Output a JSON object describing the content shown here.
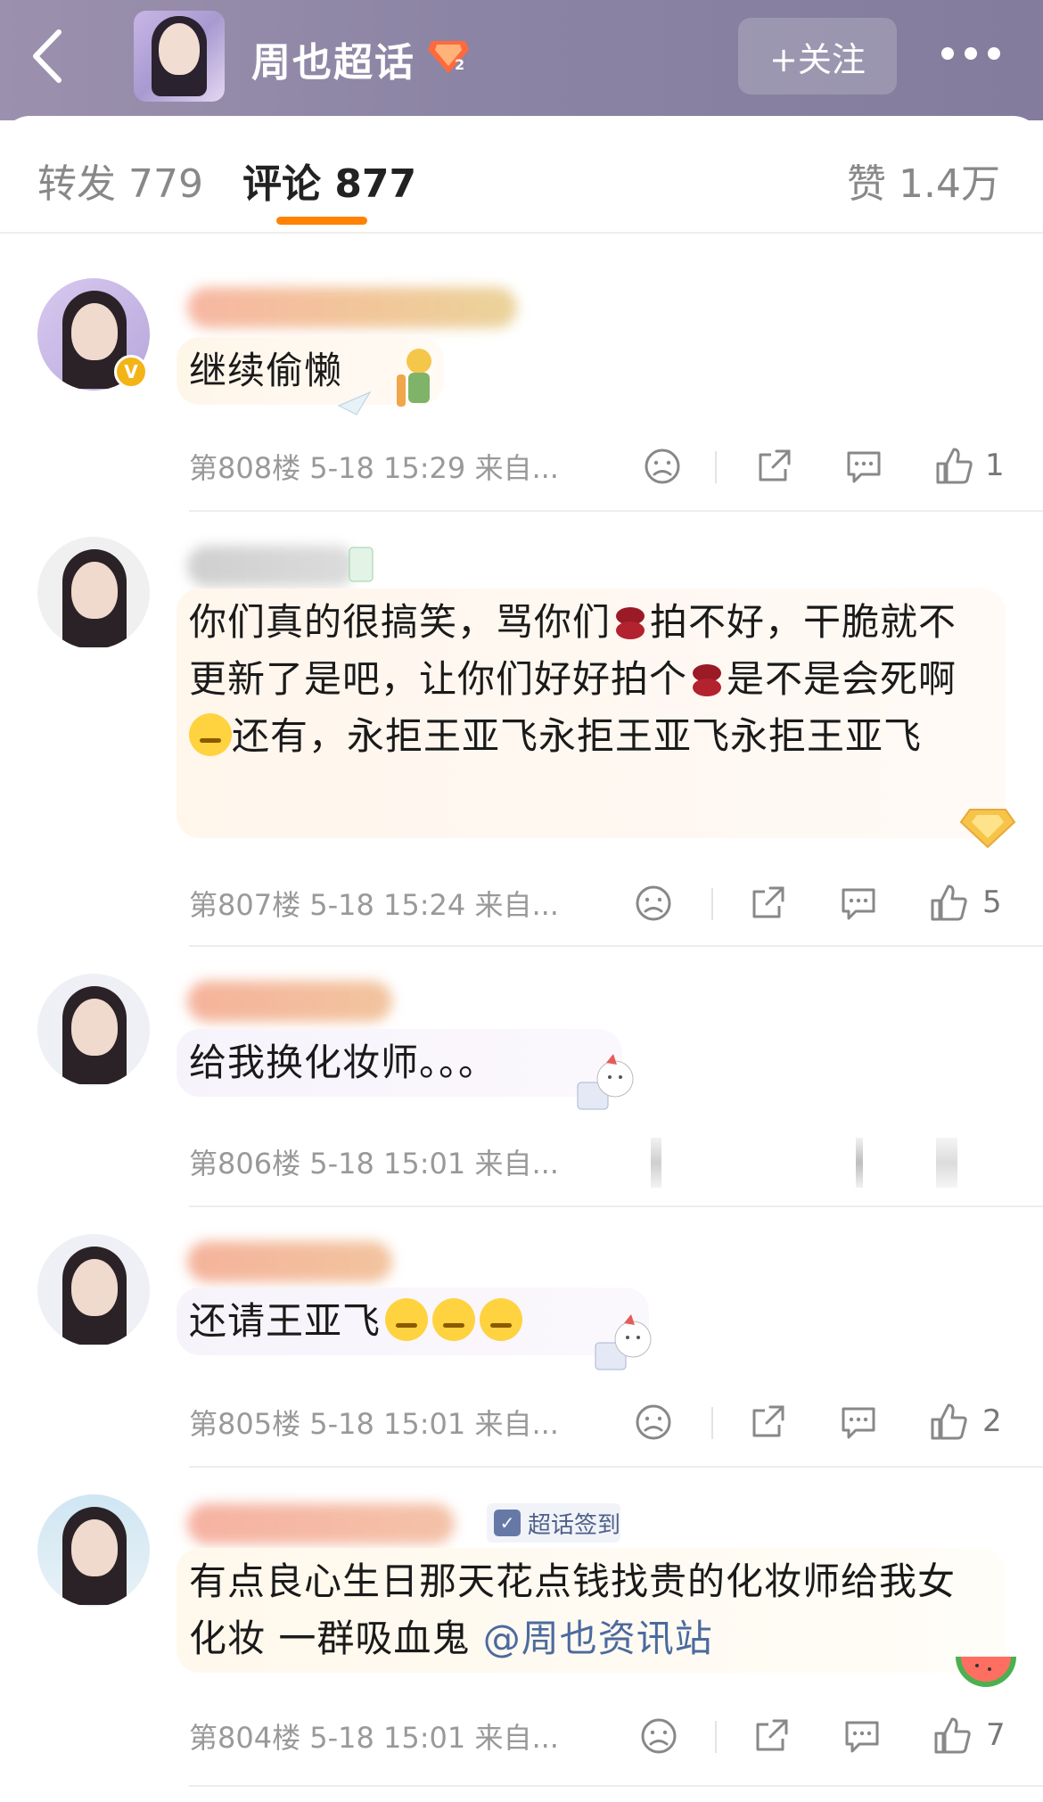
{
  "header": {
    "title": "周也超话",
    "follow_label": "+关注",
    "level_badge": "2"
  },
  "tabs": {
    "repost": "转发 779",
    "comment": "评论 877",
    "like": "赞 1.4万"
  },
  "colors": {
    "accent": "#ff8200",
    "header_bg": "#9089a6",
    "mention": "#4b6a9e"
  },
  "comments": [
    {
      "text": "继续偷懒",
      "meta": "第808楼 5-18 15:29 来自...",
      "likes": "1",
      "avatar_badge": "V"
    },
    {
      "text": "你们真的很搞笑，骂你们",
      "text2": "拍不好，干脆就不更新了是吧，让你们好好拍个",
      "text3": "是不是会死啊",
      "text4": "还有，永拒王亚飞永拒王亚飞永拒王亚飞",
      "meta": "第807楼 5-18 15:24 来自...",
      "likes": "5"
    },
    {
      "text": "给我换化妆师。。。",
      "meta": "第806楼 5-18 15:01 来自...",
      "likes": ""
    },
    {
      "text": "还请王亚飞",
      "meta": "第805楼 5-18 15:01 来自...",
      "likes": "2"
    },
    {
      "text": "有点良心生日那天花点钱找贵的化妆师给我女化妆 一群吸血鬼",
      "mention": "@周也资讯站",
      "meta": "第804楼 5-18 15:01 来自...",
      "likes": "7",
      "chip": "超话签到"
    }
  ]
}
